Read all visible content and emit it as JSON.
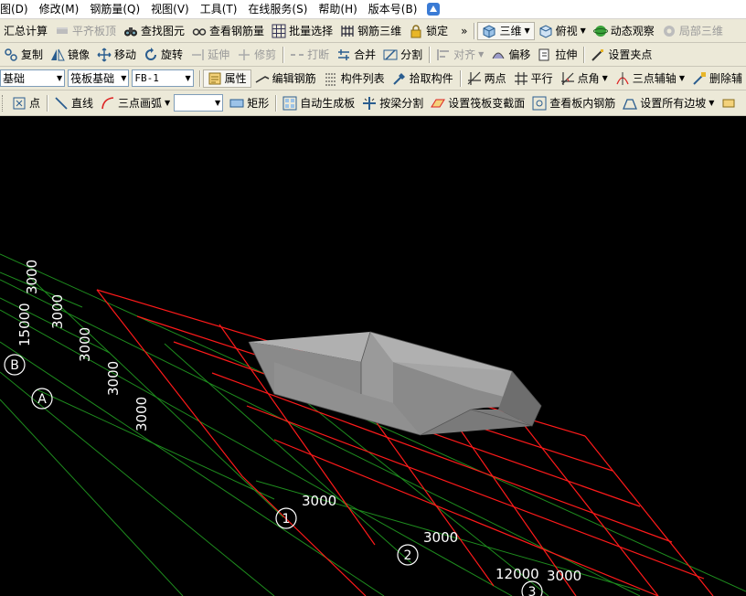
{
  "menubar": {
    "items": [
      "图(D)",
      "修改(M)",
      "钢筋量(Q)",
      "视图(V)",
      "工具(T)",
      "在线服务(S)",
      "帮助(H)",
      "版本号(B)"
    ]
  },
  "toolbar1": {
    "summary": "汇总计算",
    "flat_board_top": "平齐板顶",
    "find_element": "查找图元",
    "view_rebar_qty": "查看钢筋量",
    "batch_select": "批量选择",
    "rebar_3d": "钢筋三维",
    "lock": "锁定",
    "more": "»",
    "view_3d": "三维",
    "top_view": "俯视",
    "dynamic_observe": "动态观察",
    "partial_3d": "局部三维"
  },
  "toolbar2": {
    "copy": "复制",
    "mirror": "镜像",
    "move": "移动",
    "rotate": "旋转",
    "extend": "延伸",
    "trim": "修剪",
    "break": "打断",
    "merge": "合并",
    "split": "分割",
    "align": "对齐",
    "offset": "偏移",
    "stretch": "拉伸",
    "set_clip_point": "设置夹点"
  },
  "toolbar3": {
    "layer_select": "基础",
    "type_select": "筏板基础",
    "element_select": "FB-1",
    "properties": "属性",
    "edit_rebar": "编辑钢筋",
    "element_list": "构件列表",
    "pick_element": "拾取构件",
    "two_points": "两点",
    "parallel": "平行",
    "point_angle": "点角",
    "three_point_axis": "三点辅轴",
    "delete_axis": "删除辅"
  },
  "toolbar4": {
    "point": "点",
    "line": "直线",
    "three_point_arc": "三点画弧",
    "arc_select": "",
    "rectangle": "矩形",
    "auto_generate_board": "自动生成板",
    "split_by_beam": "按梁分割",
    "set_raft_section": "设置筏板变截面",
    "view_board_rebar": "查看板内钢筋",
    "set_all_slopes": "设置所有边坡"
  },
  "canvas": {
    "axis_rows": [
      "A",
      "B"
    ],
    "axis_cols": [
      "1",
      "2",
      "3"
    ],
    "row_spacings": [
      "3000",
      "3000",
      "3000",
      "3000",
      "3000"
    ],
    "row_total": "15000",
    "col_spacings": [
      "3000",
      "3000",
      "3000"
    ],
    "col_total": "12000",
    "colors": {
      "background": "#000000",
      "grid_line": "#1e8c1e",
      "raft_outline": "#ff1a1a",
      "dim_text": "#ffffff",
      "solid_top": "#b0b0b0",
      "solid_front": "#8a8a8a",
      "solid_side": "#6e6e6e"
    }
  }
}
